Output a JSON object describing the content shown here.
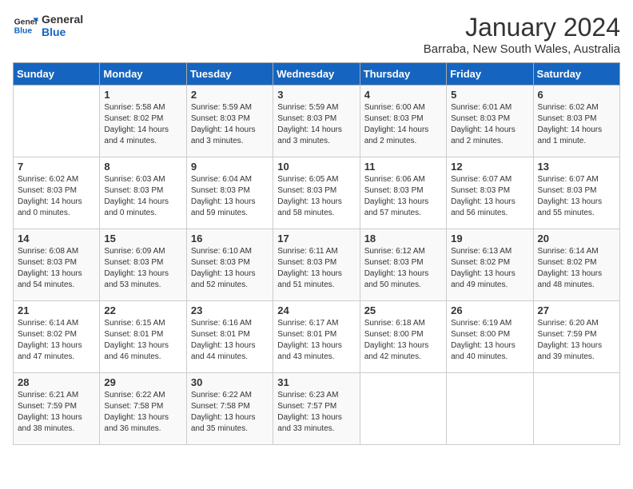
{
  "logo": {
    "text_general": "General",
    "text_blue": "Blue"
  },
  "title": "January 2024",
  "subtitle": "Barraba, New South Wales, Australia",
  "days_of_week": [
    "Sunday",
    "Monday",
    "Tuesday",
    "Wednesday",
    "Thursday",
    "Friday",
    "Saturday"
  ],
  "weeks": [
    [
      {
        "num": "",
        "info": ""
      },
      {
        "num": "1",
        "info": "Sunrise: 5:58 AM\nSunset: 8:02 PM\nDaylight: 14 hours\nand 4 minutes."
      },
      {
        "num": "2",
        "info": "Sunrise: 5:59 AM\nSunset: 8:03 PM\nDaylight: 14 hours\nand 3 minutes."
      },
      {
        "num": "3",
        "info": "Sunrise: 5:59 AM\nSunset: 8:03 PM\nDaylight: 14 hours\nand 3 minutes."
      },
      {
        "num": "4",
        "info": "Sunrise: 6:00 AM\nSunset: 8:03 PM\nDaylight: 14 hours\nand 2 minutes."
      },
      {
        "num": "5",
        "info": "Sunrise: 6:01 AM\nSunset: 8:03 PM\nDaylight: 14 hours\nand 2 minutes."
      },
      {
        "num": "6",
        "info": "Sunrise: 6:02 AM\nSunset: 8:03 PM\nDaylight: 14 hours\nand 1 minute."
      }
    ],
    [
      {
        "num": "7",
        "info": "Sunrise: 6:02 AM\nSunset: 8:03 PM\nDaylight: 14 hours\nand 0 minutes."
      },
      {
        "num": "8",
        "info": "Sunrise: 6:03 AM\nSunset: 8:03 PM\nDaylight: 14 hours\nand 0 minutes."
      },
      {
        "num": "9",
        "info": "Sunrise: 6:04 AM\nSunset: 8:03 PM\nDaylight: 13 hours\nand 59 minutes."
      },
      {
        "num": "10",
        "info": "Sunrise: 6:05 AM\nSunset: 8:03 PM\nDaylight: 13 hours\nand 58 minutes."
      },
      {
        "num": "11",
        "info": "Sunrise: 6:06 AM\nSunset: 8:03 PM\nDaylight: 13 hours\nand 57 minutes."
      },
      {
        "num": "12",
        "info": "Sunrise: 6:07 AM\nSunset: 8:03 PM\nDaylight: 13 hours\nand 56 minutes."
      },
      {
        "num": "13",
        "info": "Sunrise: 6:07 AM\nSunset: 8:03 PM\nDaylight: 13 hours\nand 55 minutes."
      }
    ],
    [
      {
        "num": "14",
        "info": "Sunrise: 6:08 AM\nSunset: 8:03 PM\nDaylight: 13 hours\nand 54 minutes."
      },
      {
        "num": "15",
        "info": "Sunrise: 6:09 AM\nSunset: 8:03 PM\nDaylight: 13 hours\nand 53 minutes."
      },
      {
        "num": "16",
        "info": "Sunrise: 6:10 AM\nSunset: 8:03 PM\nDaylight: 13 hours\nand 52 minutes."
      },
      {
        "num": "17",
        "info": "Sunrise: 6:11 AM\nSunset: 8:03 PM\nDaylight: 13 hours\nand 51 minutes."
      },
      {
        "num": "18",
        "info": "Sunrise: 6:12 AM\nSunset: 8:03 PM\nDaylight: 13 hours\nand 50 minutes."
      },
      {
        "num": "19",
        "info": "Sunrise: 6:13 AM\nSunset: 8:02 PM\nDaylight: 13 hours\nand 49 minutes."
      },
      {
        "num": "20",
        "info": "Sunrise: 6:14 AM\nSunset: 8:02 PM\nDaylight: 13 hours\nand 48 minutes."
      }
    ],
    [
      {
        "num": "21",
        "info": "Sunrise: 6:14 AM\nSunset: 8:02 PM\nDaylight: 13 hours\nand 47 minutes."
      },
      {
        "num": "22",
        "info": "Sunrise: 6:15 AM\nSunset: 8:01 PM\nDaylight: 13 hours\nand 46 minutes."
      },
      {
        "num": "23",
        "info": "Sunrise: 6:16 AM\nSunset: 8:01 PM\nDaylight: 13 hours\nand 44 minutes."
      },
      {
        "num": "24",
        "info": "Sunrise: 6:17 AM\nSunset: 8:01 PM\nDaylight: 13 hours\nand 43 minutes."
      },
      {
        "num": "25",
        "info": "Sunrise: 6:18 AM\nSunset: 8:00 PM\nDaylight: 13 hours\nand 42 minutes."
      },
      {
        "num": "26",
        "info": "Sunrise: 6:19 AM\nSunset: 8:00 PM\nDaylight: 13 hours\nand 40 minutes."
      },
      {
        "num": "27",
        "info": "Sunrise: 6:20 AM\nSunset: 7:59 PM\nDaylight: 13 hours\nand 39 minutes."
      }
    ],
    [
      {
        "num": "28",
        "info": "Sunrise: 6:21 AM\nSunset: 7:59 PM\nDaylight: 13 hours\nand 38 minutes."
      },
      {
        "num": "29",
        "info": "Sunrise: 6:22 AM\nSunset: 7:58 PM\nDaylight: 13 hours\nand 36 minutes."
      },
      {
        "num": "30",
        "info": "Sunrise: 6:22 AM\nSunset: 7:58 PM\nDaylight: 13 hours\nand 35 minutes."
      },
      {
        "num": "31",
        "info": "Sunrise: 6:23 AM\nSunset: 7:57 PM\nDaylight: 13 hours\nand 33 minutes."
      },
      {
        "num": "",
        "info": ""
      },
      {
        "num": "",
        "info": ""
      },
      {
        "num": "",
        "info": ""
      }
    ]
  ]
}
